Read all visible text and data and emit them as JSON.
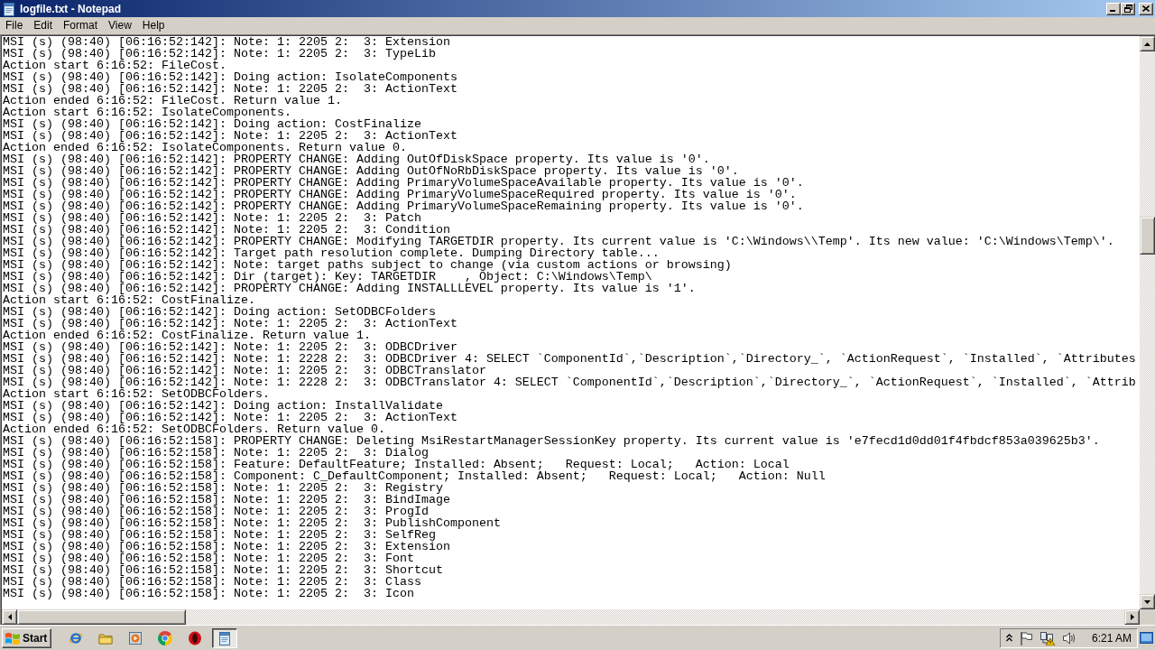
{
  "window": {
    "title": "logfile.txt - Notepad"
  },
  "menu": [
    "File",
    "Edit",
    "Format",
    "View",
    "Help"
  ],
  "document": {
    "lines": [
      "MSI (s) (98:40) [06:16:52:142]: Note: 1: 2205 2:  3: Extension",
      "MSI (s) (98:40) [06:16:52:142]: Note: 1: 2205 2:  3: TypeLib",
      "Action start 6:16:52: FileCost.",
      "MSI (s) (98:40) [06:16:52:142]: Doing action: IsolateComponents",
      "MSI (s) (98:40) [06:16:52:142]: Note: 1: 2205 2:  3: ActionText",
      "Action ended 6:16:52: FileCost. Return value 1.",
      "Action start 6:16:52: IsolateComponents.",
      "MSI (s) (98:40) [06:16:52:142]: Doing action: CostFinalize",
      "MSI (s) (98:40) [06:16:52:142]: Note: 1: 2205 2:  3: ActionText",
      "Action ended 6:16:52: IsolateComponents. Return value 0.",
      "MSI (s) (98:40) [06:16:52:142]: PROPERTY CHANGE: Adding OutOfDiskSpace property. Its value is '0'.",
      "MSI (s) (98:40) [06:16:52:142]: PROPERTY CHANGE: Adding OutOfNoRbDiskSpace property. Its value is '0'.",
      "MSI (s) (98:40) [06:16:52:142]: PROPERTY CHANGE: Adding PrimaryVolumeSpaceAvailable property. Its value is '0'.",
      "MSI (s) (98:40) [06:16:52:142]: PROPERTY CHANGE: Adding PrimaryVolumeSpaceRequired property. Its value is '0'.",
      "MSI (s) (98:40) [06:16:52:142]: PROPERTY CHANGE: Adding PrimaryVolumeSpaceRemaining property. Its value is '0'.",
      "MSI (s) (98:40) [06:16:52:142]: Note: 1: 2205 2:  3: Patch",
      "MSI (s) (98:40) [06:16:52:142]: Note: 1: 2205 2:  3: Condition",
      "MSI (s) (98:40) [06:16:52:142]: PROPERTY CHANGE: Modifying TARGETDIR property. Its current value is 'C:\\Windows\\\\Temp'. Its new value: 'C:\\Windows\\Temp\\'.",
      "MSI (s) (98:40) [06:16:52:142]: Target path resolution complete. Dumping Directory table...",
      "MSI (s) (98:40) [06:16:52:142]: Note: target paths subject to change (via custom actions or browsing)",
      "MSI (s) (98:40) [06:16:52:142]: Dir (target): Key: TARGETDIR    , Object: C:\\Windows\\Temp\\",
      "MSI (s) (98:40) [06:16:52:142]: PROPERTY CHANGE: Adding INSTALLLEVEL property. Its value is '1'.",
      "Action start 6:16:52: CostFinalize.",
      "MSI (s) (98:40) [06:16:52:142]: Doing action: SetODBCFolders",
      "MSI (s) (98:40) [06:16:52:142]: Note: 1: 2205 2:  3: ActionText",
      "Action ended 6:16:52: CostFinalize. Return value 1.",
      "MSI (s) (98:40) [06:16:52:142]: Note: 1: 2205 2:  3: ODBCDriver",
      "MSI (s) (98:40) [06:16:52:142]: Note: 1: 2228 2:  3: ODBCDriver 4: SELECT `ComponentId`,`Description`,`Directory_`, `ActionRequest`, `Installed`, `Attributes",
      "MSI (s) (98:40) [06:16:52:142]: Note: 1: 2205 2:  3: ODBCTranslator",
      "MSI (s) (98:40) [06:16:52:142]: Note: 1: 2228 2:  3: ODBCTranslator 4: SELECT `ComponentId`,`Description`,`Directory_`, `ActionRequest`, `Installed`, `Attrib",
      "Action start 6:16:52: SetODBCFolders.",
      "MSI (s) (98:40) [06:16:52:142]: Doing action: InstallValidate",
      "MSI (s) (98:40) [06:16:52:142]: Note: 1: 2205 2:  3: ActionText",
      "Action ended 6:16:52: SetODBCFolders. Return value 0.",
      "MSI (s) (98:40) [06:16:52:158]: PROPERTY CHANGE: Deleting MsiRestartManagerSessionKey property. Its current value is 'e7fecd1d0dd01f4fbdcf853a039625b3'.",
      "MSI (s) (98:40) [06:16:52:158]: Note: 1: 2205 2:  3: Dialog",
      "MSI (s) (98:40) [06:16:52:158]: Feature: DefaultFeature; Installed: Absent;   Request: Local;   Action: Local",
      "MSI (s) (98:40) [06:16:52:158]: Component: C_DefaultComponent; Installed: Absent;   Request: Local;   Action: Null",
      "MSI (s) (98:40) [06:16:52:158]: Note: 1: 2205 2:  3: Registry",
      "MSI (s) (98:40) [06:16:52:158]: Note: 1: 2205 2:  3: BindImage",
      "MSI (s) (98:40) [06:16:52:158]: Note: 1: 2205 2:  3: ProgId",
      "MSI (s) (98:40) [06:16:52:158]: Note: 1: 2205 2:  3: PublishComponent",
      "MSI (s) (98:40) [06:16:52:158]: Note: 1: 2205 2:  3: SelfReg",
      "MSI (s) (98:40) [06:16:52:158]: Note: 1: 2205 2:  3: Extension",
      "MSI (s) (98:40) [06:16:52:158]: Note: 1: 2205 2:  3: Font",
      "MSI (s) (98:40) [06:16:52:158]: Note: 1: 2205 2:  3: Shortcut",
      "MSI (s) (98:40) [06:16:52:158]: Note: 1: 2205 2:  3: Class",
      "MSI (s) (98:40) [06:16:52:158]: Note: 1: 2205 2:  3: Icon"
    ]
  },
  "taskbar": {
    "start": "Start",
    "buttons": [
      {
        "selected": false
      },
      {
        "selected": false
      },
      {
        "selected": false
      },
      {
        "selected": false
      },
      {
        "selected": false
      },
      {
        "selected": true
      }
    ],
    "clock": "6:21 AM"
  }
}
